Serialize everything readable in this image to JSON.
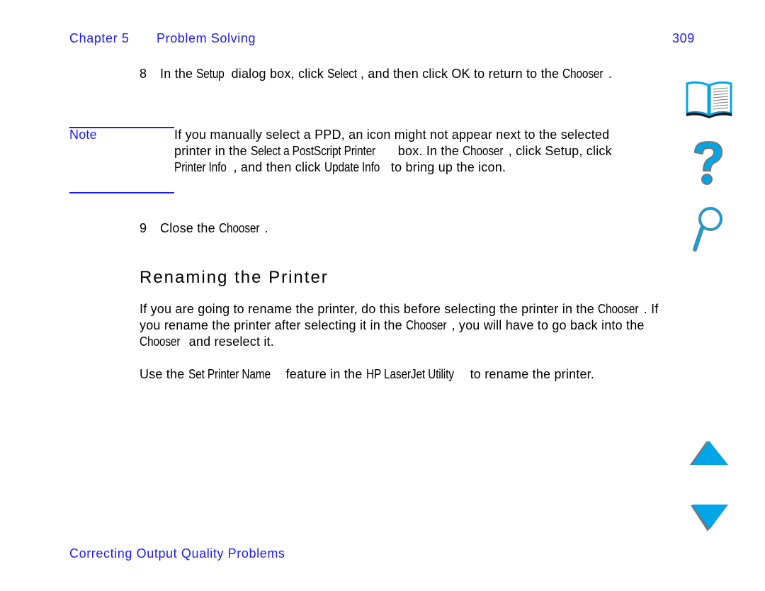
{
  "header": {
    "chapter": "Chapter 5",
    "section": "Problem Solving",
    "page": "309"
  },
  "step8": {
    "num": "8",
    "segments": [
      {
        "t": "In the "
      },
      {
        "t": "Setup",
        "ui": true
      },
      {
        "t": " dialog box, click "
      },
      {
        "t": "Select",
        "ui": true
      },
      {
        "t": ", and then click OK to return to the "
      },
      {
        "t": "Chooser",
        "ui": true
      },
      {
        "t": "."
      }
    ]
  },
  "note": {
    "label": "Note",
    "segments": [
      {
        "t": "If you manually select a PPD, an icon might not appear next to the selected printer in the "
      },
      {
        "t": "Select a PostScript Printer",
        "ui": true
      },
      {
        "t": " box. In the "
      },
      {
        "t": "Chooser",
        "ui": true
      },
      {
        "t": ", click Setup, click "
      },
      {
        "t": "Printer Info",
        "ui": true
      },
      {
        "t": ", and then click "
      },
      {
        "t": "Update Info",
        "ui": true
      },
      {
        "t": " to bring up the icon."
      }
    ]
  },
  "step9": {
    "num": "9",
    "segments": [
      {
        "t": "Close the "
      },
      {
        "t": "Chooser",
        "ui": true
      },
      {
        "t": "."
      }
    ]
  },
  "heading": "Renaming the Printer",
  "para1": {
    "segments": [
      {
        "t": "If you are going to rename the printer, do this before selecting the printer in the "
      },
      {
        "t": "Chooser",
        "ui": true
      },
      {
        "t": ". If you rename the printer after selecting it in the "
      },
      {
        "t": "Chooser",
        "ui": true
      },
      {
        "t": ", you will have to go back into the "
      },
      {
        "t": "Chooser",
        "ui": true
      },
      {
        "t": " and reselect it."
      }
    ]
  },
  "para2": {
    "segments": [
      {
        "t": "Use the "
      },
      {
        "t": "Set Printer Name",
        "ui": true
      },
      {
        "t": " feature in the "
      },
      {
        "t": "HP LaserJet Utility",
        "ui": true
      },
      {
        "t": " to rename the printer."
      }
    ]
  },
  "footer": {
    "link": "Correcting Output Quality Problems"
  },
  "nav_icons": [
    "book-icon",
    "question-mark-icon",
    "magnifier-icon",
    "arrow-up-icon",
    "arrow-down-icon"
  ],
  "colors": {
    "link": "#1a1aff",
    "icon": "#00a6e8"
  }
}
